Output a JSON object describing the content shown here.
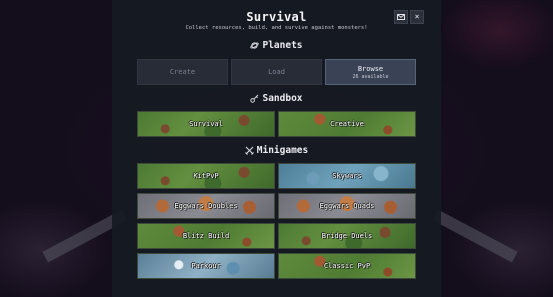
{
  "header": {
    "title": "Survival",
    "subtitle": "Collect resources, build, and survive against monsters!",
    "mail_icon": "mail-icon",
    "close_icon": "close-icon",
    "close_glyph": "×"
  },
  "planets": {
    "heading": "Planets",
    "icon": "planet-icon",
    "buttons": [
      {
        "label": "Create",
        "enabled": false
      },
      {
        "label": "Load",
        "enabled": false
      },
      {
        "label": "Browse",
        "sublabel": "26 available",
        "selected": true
      }
    ]
  },
  "sandbox": {
    "heading": "Sandbox",
    "icon": "key-icon",
    "tiles": [
      {
        "label": "Survival"
      },
      {
        "label": "Creative"
      }
    ]
  },
  "minigames": {
    "heading": "Minigames",
    "icon": "crossed-swords-icon",
    "tiles": [
      {
        "label": "KitPvP"
      },
      {
        "label": "Skywars"
      },
      {
        "label": "Eggwars Doubles"
      },
      {
        "label": "Eggwars Quads"
      },
      {
        "label": "Blitz Build"
      },
      {
        "label": "Bridge Duels"
      },
      {
        "label": "Parkour"
      },
      {
        "label": "Classic PvP"
      }
    ]
  }
}
